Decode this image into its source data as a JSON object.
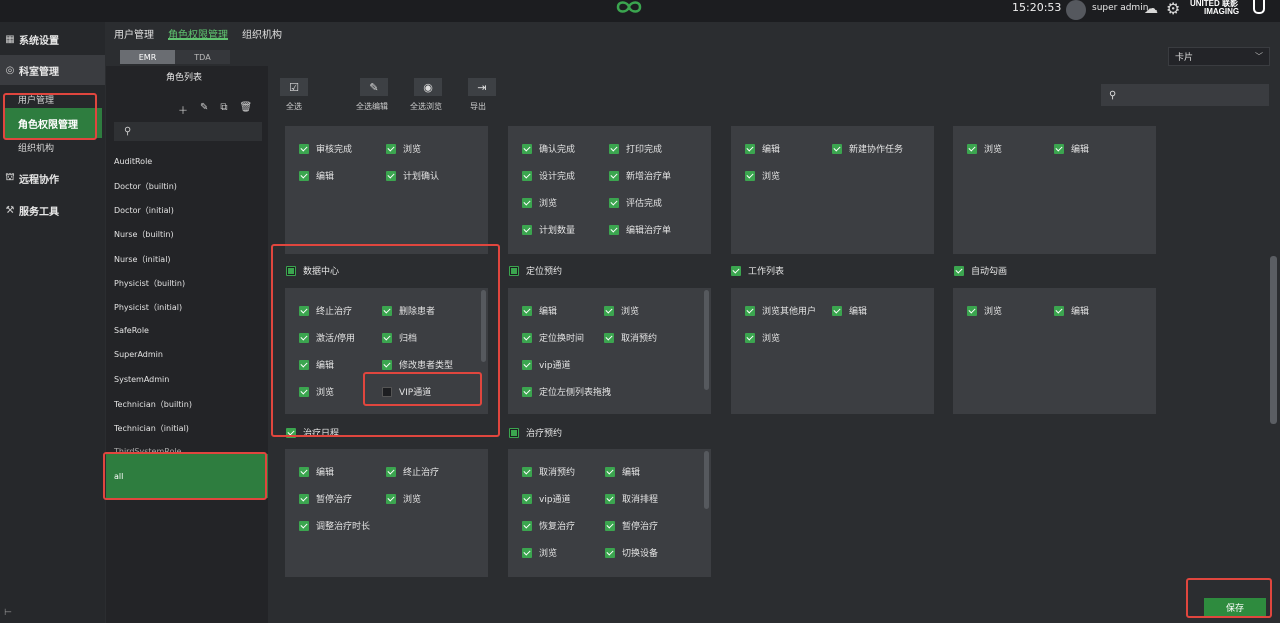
{
  "topbar": {
    "time": "15:20:53",
    "user": "super admin",
    "brand_line1": "UNITED 联影",
    "brand_line2": "IMAGING"
  },
  "nav": {
    "items": [
      {
        "label": "系统设置",
        "icon": "grid-icon"
      },
      {
        "label": "科室管理",
        "icon": "department-icon"
      },
      {
        "label": "远程协作",
        "icon": "remote-icon"
      },
      {
        "label": "服务工具",
        "icon": "tools-icon"
      }
    ],
    "sub_items": [
      "用户管理",
      "角色权限管理",
      "组织机构"
    ]
  },
  "tabs": [
    "用户管理",
    "角色权限管理",
    "组织机构"
  ],
  "segment": [
    "EMR",
    "TDA"
  ],
  "view_select": "卡片",
  "roles": {
    "title": "角色列表",
    "list": [
      "AuditRole",
      "Doctor（builtin)",
      "Doctor（initial)",
      "Nurse（builtin)",
      "Nurse（initial)",
      "Physicist（builtin)",
      "Physicist（initial)",
      "SafeRole",
      "SuperAdmin",
      "SystemAdmin",
      "Technician（builtin)",
      "Technician（initial)",
      "ThirdSystemRole",
      "all"
    ]
  },
  "toolbar": [
    "全选",
    "全选编辑",
    "全选浏览",
    "导出"
  ],
  "cards_top": [
    {
      "perms": [
        [
          "审核完成",
          "浏览"
        ],
        [
          "编辑",
          "计划确认"
        ]
      ]
    },
    {
      "perms": [
        [
          "确认完成",
          "打印完成"
        ],
        [
          "设计完成",
          "新增治疗单"
        ],
        [
          "浏览",
          "评估完成"
        ],
        [
          "计划数量",
          "编辑治疗单"
        ]
      ]
    },
    {
      "perms": [
        [
          "编辑",
          "新建协作任务"
        ],
        [
          "浏览",
          ""
        ]
      ]
    },
    {
      "perms": [
        [
          "浏览",
          "编辑"
        ]
      ]
    }
  ],
  "sections_mid": [
    "数据中心",
    "定位预约",
    "工作列表",
    "自动勾画"
  ],
  "cards_mid": [
    {
      "perms": [
        [
          "终止治疗",
          "删除患者"
        ],
        [
          "激活/停用",
          "归档"
        ],
        [
          "编辑",
          "修改患者类型"
        ],
        [
          "浏览",
          "VIP通道"
        ]
      ]
    },
    {
      "perms": [
        [
          "编辑",
          "浏览"
        ],
        [
          "定位换时间",
          "取消预约"
        ],
        [
          "vip通道",
          ""
        ],
        [
          "定位左侧列表拖拽",
          ""
        ]
      ]
    },
    {
      "perms": [
        [
          "浏览其他用户",
          "编辑"
        ],
        [
          "浏览",
          ""
        ]
      ]
    },
    {
      "perms": [
        [
          "浏览",
          "编辑"
        ]
      ]
    }
  ],
  "sections_bot": [
    "治疗日程",
    "治疗预约"
  ],
  "cards_bot": [
    {
      "perms": [
        [
          "编辑",
          "终止治疗"
        ],
        [
          "暂停治疗",
          "浏览"
        ],
        [
          "调整治疗时长",
          ""
        ]
      ]
    },
    {
      "perms": [
        [
          "取消预约",
          "编辑"
        ],
        [
          "vip通道",
          "取消排程"
        ],
        [
          "恢复治疗",
          "暂停治疗"
        ],
        [
          "浏览",
          "切换设备"
        ]
      ]
    }
  ],
  "save_label": "保存"
}
